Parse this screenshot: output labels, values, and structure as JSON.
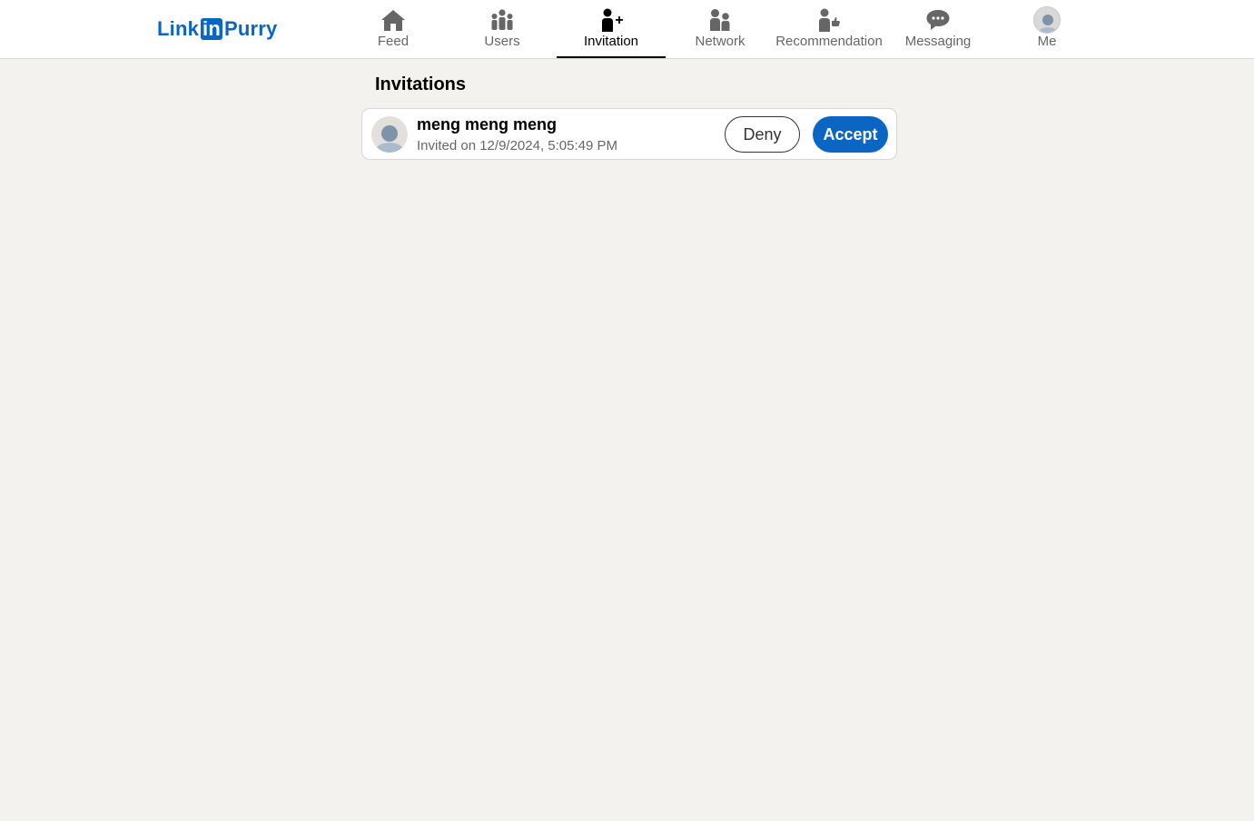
{
  "header": {
    "logo": {
      "part1": "Link",
      "part2": "in",
      "part3": "Purry"
    },
    "nav": [
      {
        "label": "Feed",
        "icon": "home-icon",
        "active": false
      },
      {
        "label": "Users",
        "icon": "users-icon",
        "active": false
      },
      {
        "label": "Invitation",
        "icon": "person-add-icon",
        "active": true
      },
      {
        "label": "Network",
        "icon": "network-icon",
        "active": false
      },
      {
        "label": "Recommendation",
        "icon": "person-thumbsup-icon",
        "active": false
      },
      {
        "label": "Messaging",
        "icon": "chat-bubble-icon",
        "active": false
      },
      {
        "label": "Me",
        "icon": "avatar",
        "active": false
      }
    ]
  },
  "main": {
    "title": "Invitations",
    "invitations": [
      {
        "name": "meng meng meng",
        "date": "Invited on 12/9/2024, 5:05:49 PM",
        "deny_label": "Deny",
        "accept_label": "Accept"
      }
    ]
  },
  "colors": {
    "brand": "#0a66c2",
    "background": "#f3f2ef",
    "nav_inactive": "#666666",
    "nav_active": "#000000"
  }
}
